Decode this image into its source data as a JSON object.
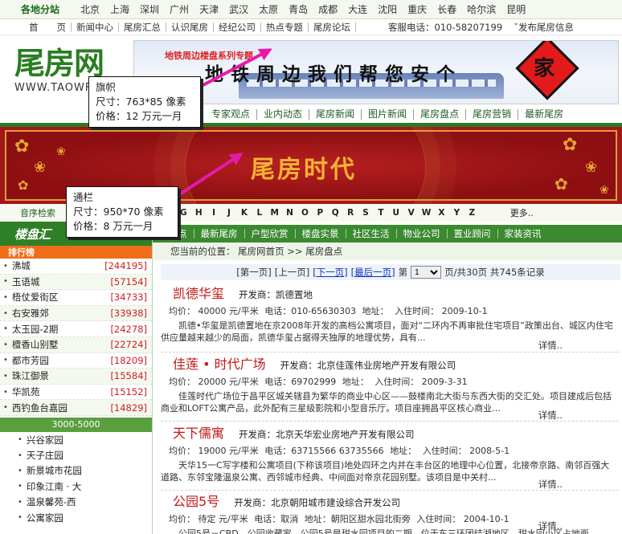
{
  "citybar": {
    "label": "各地分站",
    "cities": [
      "北京",
      "上海",
      "深圳",
      "广州",
      "天津",
      "武汉",
      "太原",
      "青岛",
      "成都",
      "大连",
      "沈阳",
      "重庆",
      "长春",
      "哈尔滨",
      "昆明"
    ]
  },
  "topnav": {
    "items": [
      "首　　页",
      "新闻中心",
      "尾房汇总",
      "认识尾房",
      "经纪公司",
      "热点专题",
      "尾房论坛"
    ],
    "phone": "客服电话：010-58207199",
    "publish": "ˇ发布尾房信息"
  },
  "logo": {
    "mark": "尾房网",
    "url": "WWW.TAOWF"
  },
  "topbanner": {
    "tag": "地铁周边楼盘系列专题",
    "slogan": "地铁周边我们帮您安个",
    "jia": "家"
  },
  "greennav": {
    "items": [
      "专家观点",
      "业内动态",
      "尾房新闻",
      "图片新闻",
      "尾房盘点",
      "尾房营销",
      "最新尾房"
    ]
  },
  "redbanner": {
    "title": "尾房时代"
  },
  "letters": {
    "label": "音序检索",
    "letters": [
      "F",
      "G",
      "H",
      "I",
      "J",
      "K",
      "L",
      "M",
      "N",
      "O",
      "P",
      "Q",
      "R",
      "S",
      "T",
      "U",
      "V",
      "W",
      "X",
      "Y",
      "Z"
    ],
    "more": "更多.."
  },
  "leftpanel": {
    "title": "楼盘汇",
    "rank_title": "排行榜",
    "rank": [
      {
        "name": "沸城",
        "count": "[244195]"
      },
      {
        "name": "玉语城",
        "count": "[57154]"
      },
      {
        "name": "梧仗爱街区",
        "count": "[34733]"
      },
      {
        "name": "右安雅郊",
        "count": "[33938]"
      },
      {
        "name": "太玉园-2期",
        "count": "[24278]"
      },
      {
        "name": "檀香山别墅",
        "count": "[22724]"
      },
      {
        "name": "都市芳园",
        "count": "[18209]"
      },
      {
        "name": "珠江御景",
        "count": "[15584]"
      },
      {
        "name": "华凯苑",
        "count": "[15152]"
      },
      {
        "name": "西钓鱼台嘉园",
        "count": "[14829]"
      }
    ],
    "band": "3000-5000",
    "sub": [
      "兴谷家园",
      "天子庄园",
      "新景城市花园",
      "印象江南 · 大",
      "温泉馨苑-西",
      "公寓家园"
    ]
  },
  "filterbar": {
    "items": [
      "尾盘点",
      "最新尾房",
      "户型欣赏",
      "楼盘实景",
      "社区生活",
      "物业公司",
      "置业顾问",
      "家装资讯"
    ]
  },
  "crumbs": "您当前的位置：   尾房网首页 >> 尾房盘点",
  "pager": {
    "first": "[第一页]",
    "prev": "[上一页]",
    "next": "[下一页]",
    "last": "[最后一页]",
    "di": "第",
    "page": "1",
    "total": "页/共30页 共745条记录"
  },
  "listings": [
    {
      "name": "凯德华玺",
      "dev": "开发商：凯德置地",
      "price": "均价：  40000  元/平米",
      "tel": "电话：010-65630303",
      "addr": "地址：",
      "time": "入住时间：  2009-10-1",
      "desc": "凯德•华玺是凯德置地在京2008年开发的高档公寓项目，面对“二环内不再审批住宅项目”政策出台、城区内住宅供应量越来越少的局面，凯德华玺占据得天独厚的地理优势，具有...",
      "more": "详情.."
    },
    {
      "name": "佳莲 • 时代广场",
      "dev": "开发商：北京佳莲伟业房地产开发有限公司",
      "price": "均价：  20000  元/平米",
      "tel": "电话：69702999",
      "addr": "地址：",
      "time": "入住时间：  2009-3-31",
      "desc": "佳莲时代广场位于昌平区城关辖县为繁华的商业中心区——鼓楼南北大街与东西大街的交汇处。项目建成后包括商业和LOFT公寓产品，此外配有三星级影院和小型音乐厅。项目座拥昌平区核心商业...",
      "more": "详情.."
    },
    {
      "name": "天下儒寓",
      "dev": "开发商：北京天华宏业房地产开发有限公司",
      "price": "均价：  19000  元/平米",
      "tel": "电话：63715566 63735566",
      "addr": "地址：",
      "time": "入住时间：  2008-5-1",
      "desc": "天华15一C写字楼和公寓项目(下称该项目)地处四环之内并在丰台区的地理中心位置，北接帝京路、南邻百强大道路、东邻宝隆温泉公寓、西邻城市经典、中间面对帝京花园别墅。该项目是中关村...",
      "more": "详情.."
    },
    {
      "name": "公园5号",
      "dev": "开发商：北京朝阳城市建设综合开发公司",
      "price": "均价：  待定  元/平米",
      "tel": "电话：取消",
      "addr": "地址：朝阳区甜水园北街旁",
      "time": "入住时间：  2004-10-1",
      "desc": "公园5号－CBD，公园收藏家。公园5号是甜水园项目的二期，位于东三环团结湖地区，甜水园小区占地面",
      "more": "详情.."
    }
  ],
  "callouts": [
    {
      "title": "旗帜",
      "size": "尺寸：763*85 像素",
      "price": "价格：12 万元一月"
    },
    {
      "title": "通栏",
      "size": "尺寸：950*70 像素",
      "price": "价格：8 万元一月"
    }
  ],
  "colors": {
    "green": "#2c7a25",
    "red_banner": "#a3161a",
    "orange": "#f06d1a",
    "magenta_arrow": "#e61aa8"
  }
}
